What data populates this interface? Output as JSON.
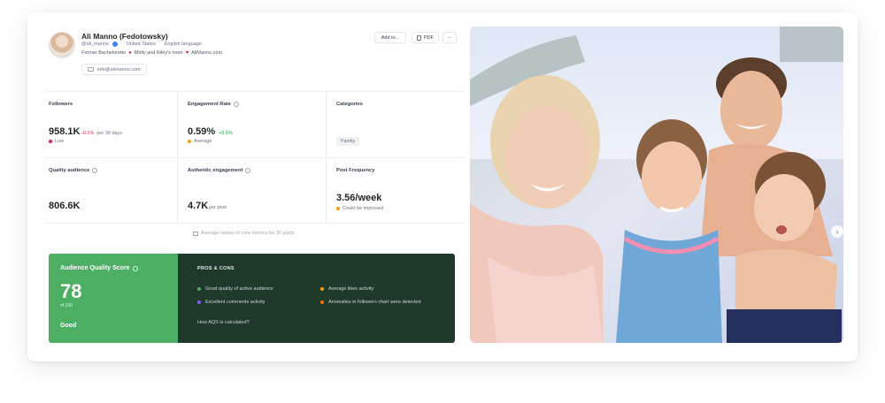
{
  "profile": {
    "name": "Ali Manno (Fedotowsky)",
    "handle": "@ali_manno",
    "country": "United States",
    "language": "English language",
    "bio_part1": "Former Bachelorette",
    "bio_part2": "Molly and Riley's mom",
    "bio_part3": "AliManno.com",
    "email": "info@alimanno.com"
  },
  "header_buttons": {
    "add_to": "Add to...",
    "pdf": "PDF",
    "more": "···"
  },
  "metrics": {
    "followers": {
      "label": "Followers",
      "value": "958.1K",
      "change": "-0.1%",
      "period": "per 30 days",
      "status": "Low"
    },
    "engagement_rate": {
      "label": "Engagement Rate",
      "value": "0.59%",
      "change": "+0.1%",
      "status": "Average"
    },
    "categories": {
      "label": "Categories",
      "tag": "Family"
    },
    "quality_audience": {
      "label": "Quality audience",
      "value": "806.6K"
    },
    "authentic_engagement": {
      "label": "Authentic engagement",
      "value": "4.7K",
      "unit": "per post"
    },
    "post_frequency": {
      "label": "Post Frequency",
      "value": "3.56/week",
      "status": "Could be improved"
    }
  },
  "average_note": "Average values of core metrics for 30 posts",
  "aqs": {
    "title": "Audience Quality Score",
    "score": "78",
    "of": "of 100",
    "rating": "Good",
    "pros_cons_title": "PROS & CONS",
    "items": [
      "Good quality of active audience",
      "Excellent comments activity",
      "Average likes activity",
      "Anomalies in followers chart were detected"
    ],
    "how_link": "How AQS is calculated?"
  },
  "colors": {
    "aqs_green": "#4caf63",
    "aqs_dark": "#1f3a2a",
    "negative": "#e11d48",
    "positive": "#16a34a",
    "average": "#f59e0b",
    "purple": "#8b5cf6"
  }
}
